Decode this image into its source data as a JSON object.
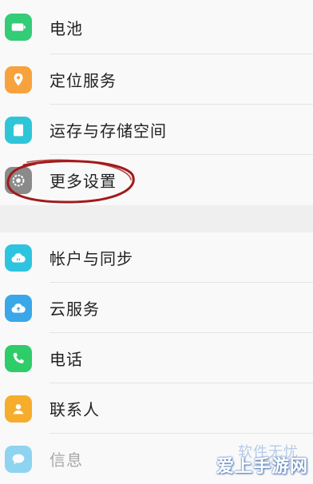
{
  "settings_group_1": {
    "items": [
      {
        "label": "电池",
        "icon": "battery-icon",
        "color": "#33cc77"
      },
      {
        "label": "定位服务",
        "icon": "location-pin-icon",
        "color": "#f7a23c"
      },
      {
        "label": "运存与存储空间",
        "icon": "sd-card-icon",
        "color": "#2fc5d8"
      },
      {
        "label": "更多设置",
        "icon": "gear-icon",
        "color": "#8a8a8a"
      }
    ]
  },
  "settings_group_2": {
    "items": [
      {
        "label": "帐户与同步",
        "icon": "cloud-sync-icon",
        "color": "#2ec4e0"
      },
      {
        "label": "云服务",
        "icon": "cloud-icon",
        "color": "#3aa7e8"
      },
      {
        "label": "电话",
        "icon": "phone-icon",
        "color": "#2fcc6a"
      },
      {
        "label": "联系人",
        "icon": "contact-icon",
        "color": "#f6ad2c"
      },
      {
        "label": "信息",
        "icon": "message-icon",
        "color": "#38b6ea"
      }
    ]
  },
  "watermark": {
    "top_text": "软件无忧",
    "bottom_text": "爱上手游网"
  },
  "annotation_color": "#a31a1a"
}
